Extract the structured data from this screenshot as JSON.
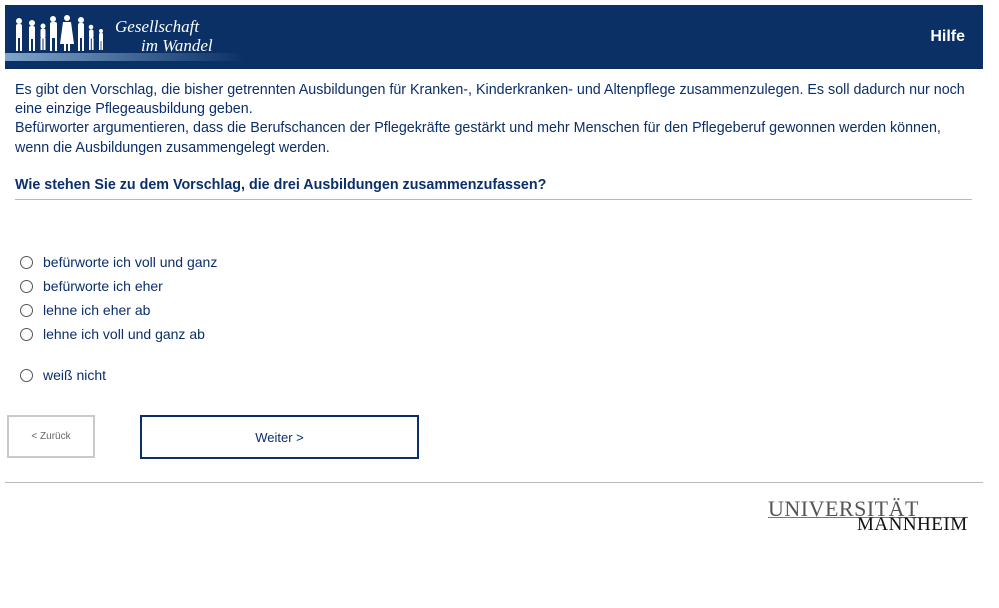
{
  "header": {
    "logo_line1": "Gesellschaft",
    "logo_line2": "im Wandel",
    "help_label": "Hilfe",
    "bg_color": "#0a3066"
  },
  "intro": {
    "paragraph1": "Es gibt den Vorschlag, die bisher getrennten Ausbildungen für Kranken-, Kinderkranken- und Altenpflege zusammenzulegen. Es soll dadurch nur noch eine einzige Pflegeausbildung geben.",
    "paragraph2": "Befürworter argumentieren, dass die Berufschancen der Pflegekräfte gestärkt und mehr Menschen für den Pflegeberuf gewonnen werden können, wenn die Ausbildungen zusammengelegt werden."
  },
  "question": {
    "text": "Wie stehen Sie zu dem Vorschlag, die drei Ausbildungen zusammenzufassen?"
  },
  "options": [
    {
      "label": "befürworte ich voll und ganz",
      "selected": false
    },
    {
      "label": "befürworte ich eher",
      "selected": false
    },
    {
      "label": "lehne ich eher ab",
      "selected": false
    },
    {
      "label": "lehne ich voll und ganz ab",
      "selected": false
    },
    {
      "label": "weiß nicht",
      "selected": false
    }
  ],
  "nav": {
    "back_label": "< Zurück",
    "next_label": "Weiter >"
  },
  "footer": {
    "logo_line1": "UNIVERSITÄT",
    "logo_line2": "MANNHEIM"
  }
}
